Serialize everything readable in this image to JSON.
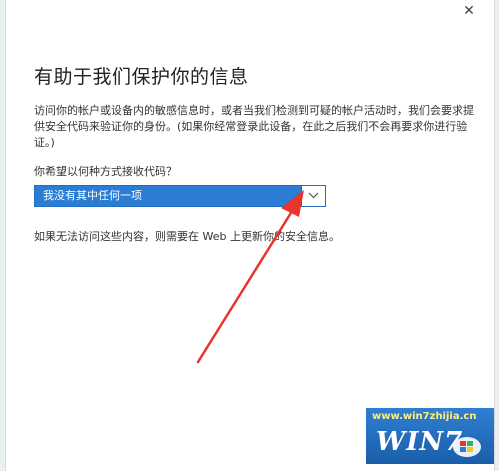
{
  "window": {
    "close_glyph": "✕"
  },
  "content": {
    "title": "有助于我们保护你的信息",
    "description": "访问你的帐户或设备内的敏感信息时，或者当我们检测到可疑的帐户活动时，我们会要求提供安全代码来验证你的身份。(如果你经常登录此设备，在此之后我们不会再要求你进行验证。)",
    "question": "你希望以何种方式接收代码？",
    "dropdown": {
      "selected": "我没有其中任何一项"
    },
    "note": "如果无法访问这些内容，则需要在 Web 上更新你的安全信息。"
  },
  "watermark": {
    "url": "www.win7zhijia.cn",
    "brand": "WIN7"
  },
  "colors": {
    "accent": "#2b7cd3",
    "annotation": "#e8342c"
  }
}
